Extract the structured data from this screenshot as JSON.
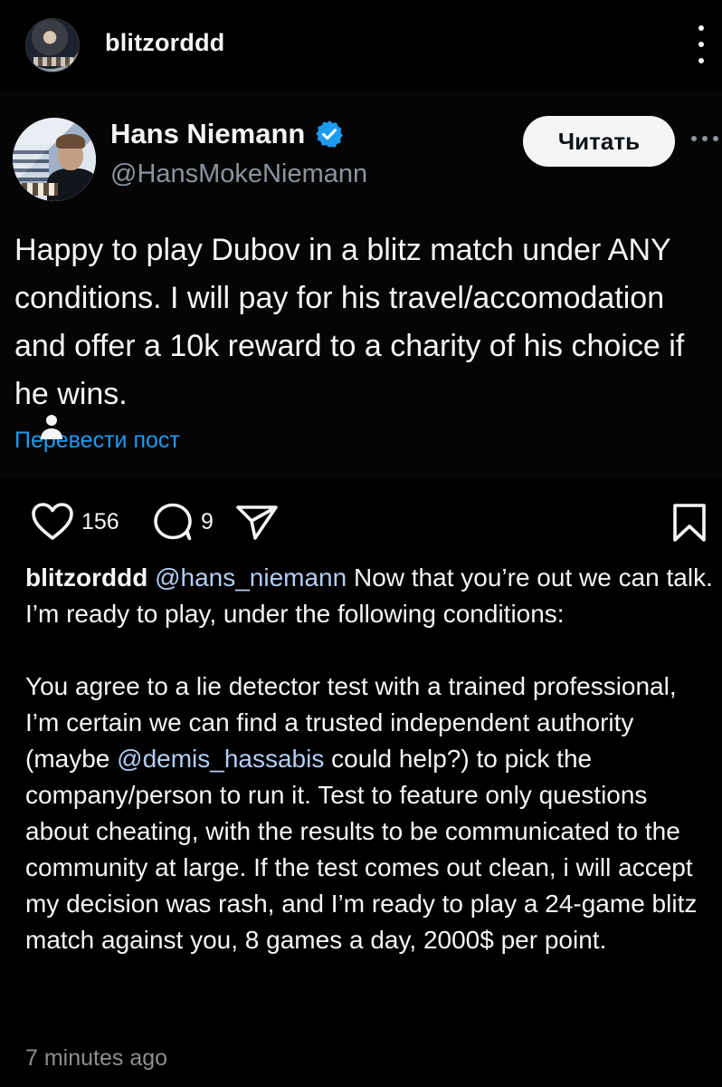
{
  "header": {
    "username": "blitzorddd",
    "avatar_icon": "profile-photo-chess",
    "more_icon": "vertical-dots-icon"
  },
  "tweet": {
    "display_name": "Hans Niemann",
    "verified_icon": "verified-badge-icon",
    "handle": "@HansMokeNiemann",
    "follow_label": "Читать",
    "more_icon": "horizontal-dots-icon",
    "text": "Happy to play Dubov in a blitz match under ANY conditions. I will pay for his travel/accomodation and offer a 10k reward to a charity of his choice if he wins.",
    "translate_label": "Перевести пост",
    "colors": {
      "link": "#1d9bf0",
      "verified": "#1d9bf0",
      "secondary": "#8b949e"
    }
  },
  "actions": {
    "likes": "156",
    "comments": "9",
    "like_icon": "heart-icon",
    "comment_icon": "comment-bubble-icon",
    "share_icon": "paper-plane-icon",
    "save_icon": "bookmark-icon"
  },
  "caption": {
    "username": "blitzorddd",
    "mention1": "@hans_niemann",
    "line1_rest": " Now that you’re out we can talk.",
    "line2": "I’m ready to play, under the following conditions:",
    "p2_a": "You agree to a lie detector test with a trained professional, I’m certain we can find a trusted independent authority (maybe ",
    "mention2": "@demis_hassabis",
    "p2_b": " could help?) to pick the company/person to run it. Test to feature only questions about cheating,  with the results to be communicated  to the community at large. If the test comes out clean, i will accept my decision was rash, and I’m ready to play a 24-game blitz match against you, 8 games a day, 2000$ per point.",
    "mention_color": "#b3cdf5"
  },
  "timestamp": "7 minutes ago"
}
